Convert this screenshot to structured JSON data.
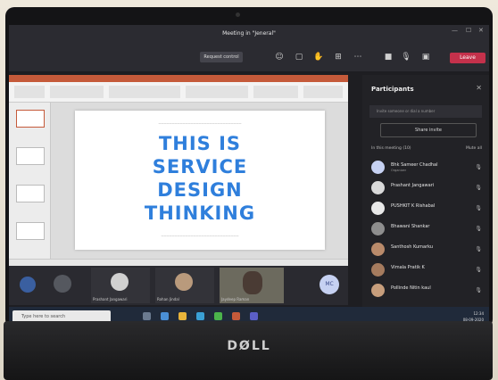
{
  "window": {
    "title": "Meeting in \"Jeneral\"",
    "hide_button": "Request control",
    "leave_button": "Leave"
  },
  "slide": {
    "heading_line1": "THIS IS",
    "heading_line2": "SERVICE",
    "heading_line3": "DESIGN",
    "heading_line4": "THINKING"
  },
  "participants_panel": {
    "title": "Participants",
    "invite_placeholder": "Invite someone or dial a number",
    "share_invite_label": "Share invite",
    "in_meeting_label": "In this meeting (10)",
    "mute_all_label": "Mute all",
    "people": [
      {
        "name": "Bhk Sameer Chadhal",
        "sub": "Organizer"
      },
      {
        "name": "Prashant Jangawari",
        "sub": ""
      },
      {
        "name": "PUSHKIT K Rishabal",
        "sub": ""
      },
      {
        "name": "Bhawani Shankar",
        "sub": ""
      },
      {
        "name": "Santhosh Kumarku",
        "sub": ""
      },
      {
        "name": "Vimala Pratik K",
        "sub": ""
      },
      {
        "name": "Pollinde Nitin kaul",
        "sub": ""
      }
    ]
  },
  "strip": {
    "tile1_label": "Prashant Jangawari",
    "tile2_label": "Rohan Jindal",
    "tile3_label": "Jaydeep Raman",
    "tile4_initials": "MC"
  },
  "taskbar": {
    "search_placeholder": "Type here to search",
    "time": "12:34",
    "date": "08-09-2020"
  },
  "device": {
    "brand": "DØLL"
  },
  "colors": {
    "leave": "#c4314b",
    "slide_text": "#2f7fdc",
    "ppt_accent": "#c55a3a"
  }
}
